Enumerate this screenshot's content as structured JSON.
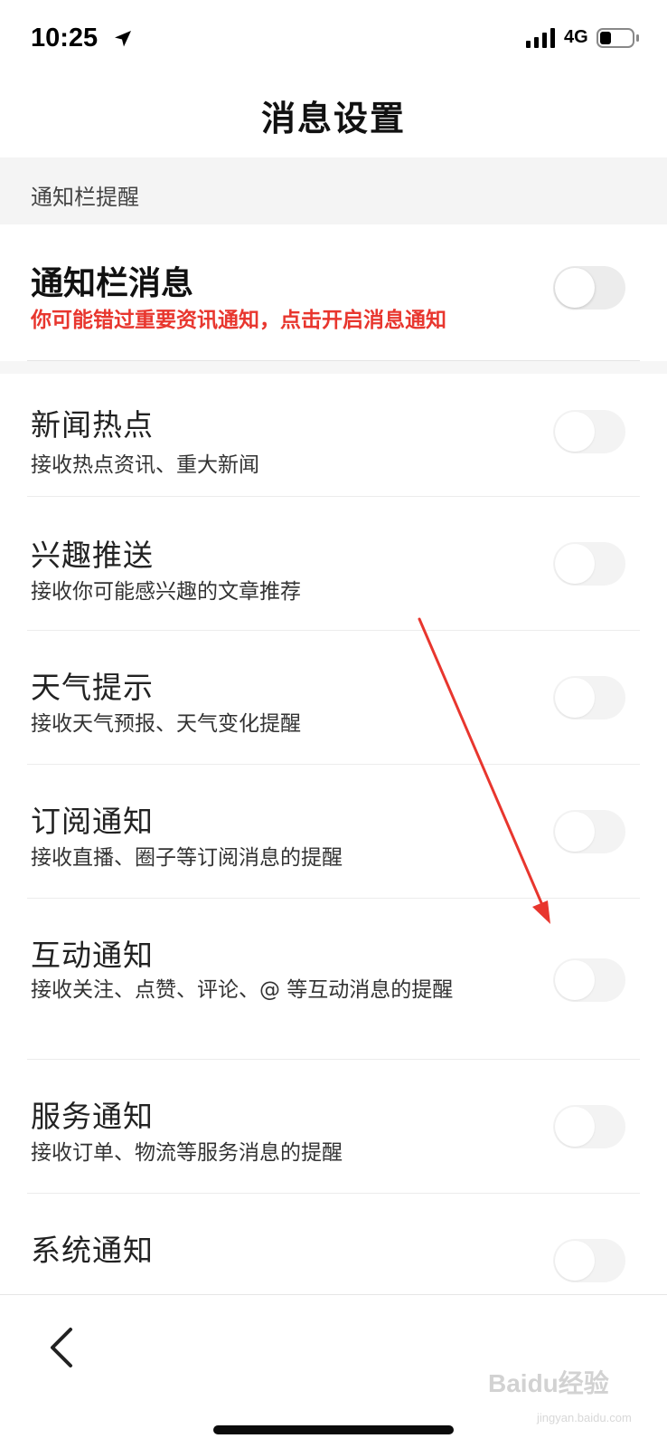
{
  "status_bar": {
    "time": "10:25",
    "network": "4G",
    "location_icon": "location-arrow-icon",
    "signal_icon": "signal-bars-icon",
    "battery_icon": "battery-icon",
    "battery_level": 0.35
  },
  "nav": {
    "title": "消息设置"
  },
  "section": {
    "label": "通知栏提醒"
  },
  "main_notification": {
    "title": "通知栏消息",
    "warning": "你可能错过重要资讯通知，点击开启消息通知",
    "enabled": false
  },
  "items": [
    {
      "title": "新闻热点",
      "desc": "接收热点资讯、重大新闻",
      "enabled": false
    },
    {
      "title": "兴趣推送",
      "desc": "接收你可能感兴趣的文章推荐",
      "enabled": false
    },
    {
      "title": "天气提示",
      "desc": "接收天气预报、天气变化提醒",
      "enabled": false
    },
    {
      "title": "订阅通知",
      "desc": "接收直播、圈子等订阅消息的提醒",
      "enabled": false
    },
    {
      "title": "互动通知",
      "desc": "接收关注、点赞、评论、@ 等互动消息的提醒",
      "enabled": false
    },
    {
      "title": "服务通知",
      "desc": "接收订单、物流等服务消息的提醒",
      "enabled": false
    },
    {
      "title": "系统通知",
      "desc": "",
      "enabled": false
    }
  ],
  "bottom": {
    "back_icon": "chevron-left-icon",
    "watermark": "Baidu经验",
    "watermark_sub": "jingyan.baidu.com"
  },
  "colors": {
    "warning": "#e8362e",
    "annotation_arrow": "#e8362e",
    "section_bg": "#f4f4f4",
    "toggle_off": "#ececec"
  }
}
